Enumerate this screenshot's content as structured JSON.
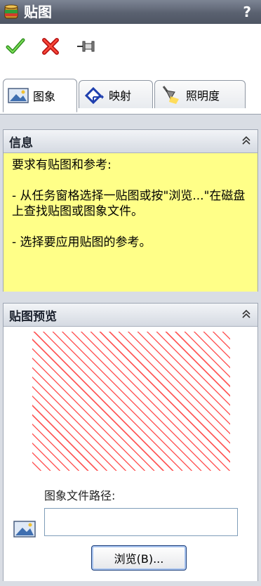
{
  "window": {
    "title": "贴图",
    "help_label": "?",
    "app_icon": "paint-can-icon"
  },
  "toolbar": {
    "ok_icon": "green-check-icon",
    "cancel_icon": "red-x-icon",
    "pin_icon": "pushpin-icon"
  },
  "tabs": [
    {
      "label": "图象",
      "icon": "image-icon",
      "active": true
    },
    {
      "label": "映射",
      "icon": "mapping-icon",
      "active": false
    },
    {
      "label": "照明度",
      "icon": "lamp-icon",
      "active": false
    }
  ],
  "info": {
    "title": "信息",
    "lines": [
      "要求有贴图和参考:",
      "- 从任务窗格选择一贴图或按\"浏览...\"在磁盘上查找贴图或图象文件。",
      "- 选择要应用贴图的参考。"
    ],
    "background": "#ffff88"
  },
  "preview": {
    "title": "贴图预览",
    "path_label": "图象文件路径:",
    "path_value": "",
    "browse_label": "浏览(B)...",
    "hatch_color": "#ff5a5a"
  }
}
